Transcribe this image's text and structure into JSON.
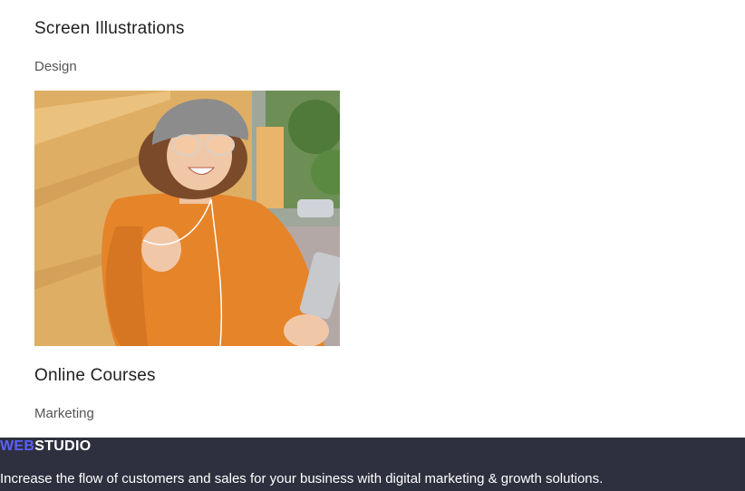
{
  "portfolio": {
    "items": [
      {
        "title": "Screen Illustrations",
        "category": "Design"
      },
      {
        "title": "Online Courses",
        "category": "Marketing"
      }
    ]
  },
  "footer": {
    "logo": {
      "part1": "WEB",
      "part2": "STUDIO"
    },
    "tagline": "Increase the flow of customers and sales for your business with digital marketing & growth solutions."
  },
  "colors": {
    "footer_bg": "#2f303f",
    "logo_accent": "#5b5fff",
    "sweater": "#e6842a"
  }
}
